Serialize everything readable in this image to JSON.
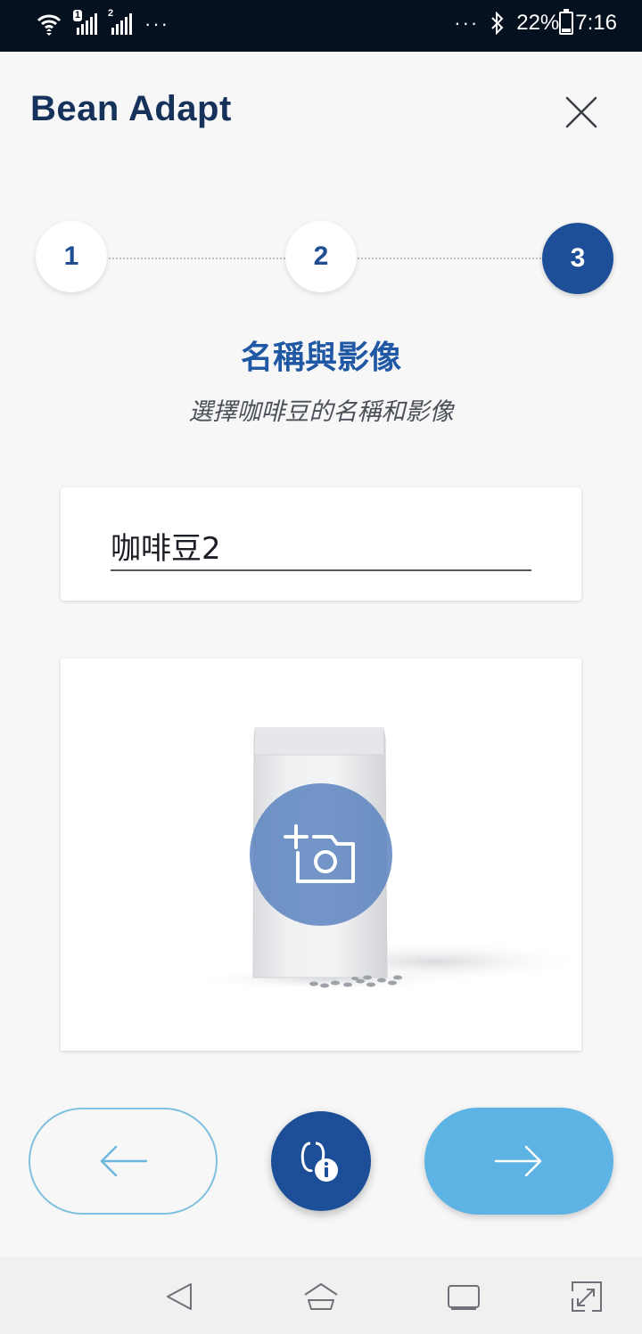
{
  "status_bar": {
    "sim1_badge": "1",
    "sim2_badge": "2",
    "left_overflow": "···",
    "right_overflow": "···",
    "battery_percent": "22%",
    "time": "7:16",
    "icons": [
      "wifi-icon",
      "signal-sim1-icon",
      "signal-sim2-icon",
      "bluetooth-icon",
      "battery-icon"
    ]
  },
  "header": {
    "title": "Bean Adapt",
    "close_icon": "close-icon"
  },
  "stepper": {
    "steps": [
      {
        "label": "1",
        "active": false
      },
      {
        "label": "2",
        "active": false
      },
      {
        "label": "3",
        "active": true
      }
    ]
  },
  "section": {
    "title": "名稱與影像",
    "subtitle": "選擇咖啡豆的名稱和影像"
  },
  "name_field": {
    "value": "咖啡豆2"
  },
  "image_card": {
    "add_photo_icon": "add-photo-icon"
  },
  "nav_buttons": {
    "back_icon": "arrow-left-icon",
    "info_icon": "bean-info-icon",
    "next_icon": "arrow-right-icon"
  },
  "system_nav": {
    "icons": [
      "back-triangle-icon",
      "home-icon",
      "recents-icon",
      "screenshot-expand-icon"
    ]
  },
  "colors": {
    "primary": "#1d4f98",
    "title_text": "#17325a",
    "accent_light": "#5db3e3",
    "outline": "#7fc0de",
    "status_bar_bg": "#06111f"
  }
}
